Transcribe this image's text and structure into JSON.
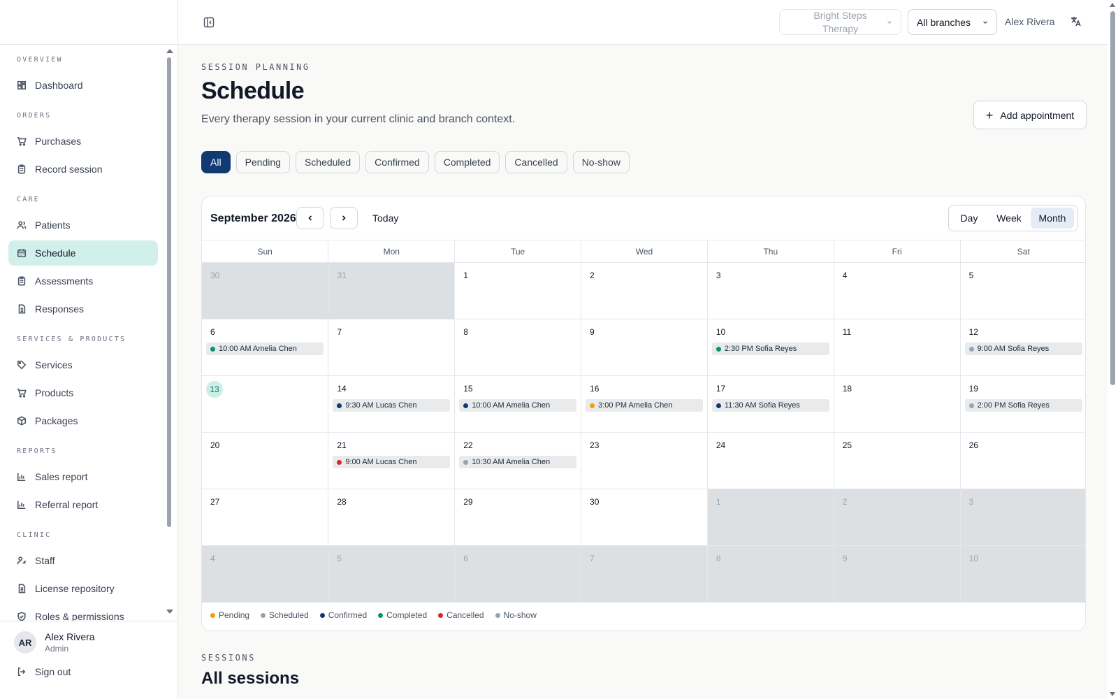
{
  "sidebar": {
    "sections": [
      {
        "label": "OVERVIEW",
        "items": [
          {
            "label": "Dashboard",
            "icon": "dashboard-icon"
          }
        ]
      },
      {
        "label": "ORDERS",
        "items": [
          {
            "label": "Purchases",
            "icon": "cart-icon"
          },
          {
            "label": "Record session",
            "icon": "clipboard-icon"
          }
        ]
      },
      {
        "label": "CARE",
        "items": [
          {
            "label": "Patients",
            "icon": "users-icon"
          },
          {
            "label": "Schedule",
            "icon": "calendar-icon",
            "active": true
          },
          {
            "label": "Assessments",
            "icon": "clipboard-icon"
          },
          {
            "label": "Responses",
            "icon": "file-icon"
          }
        ]
      },
      {
        "label": "SERVICES & PRODUCTS",
        "items": [
          {
            "label": "Services",
            "icon": "tag-icon"
          },
          {
            "label": "Products",
            "icon": "cart-icon"
          },
          {
            "label": "Packages",
            "icon": "package-icon"
          }
        ]
      },
      {
        "label": "REPORTS",
        "items": [
          {
            "label": "Sales report",
            "icon": "bar-chart-icon"
          },
          {
            "label": "Referral report",
            "icon": "bar-chart-icon"
          }
        ]
      },
      {
        "label": "CLINIC",
        "items": [
          {
            "label": "Staff",
            "icon": "staff-icon"
          },
          {
            "label": "License repository",
            "icon": "file-icon"
          },
          {
            "label": "Roles & permissions",
            "icon": "shield-icon"
          }
        ]
      }
    ],
    "user": {
      "initials": "AR",
      "name": "Alex Rivera",
      "role": "Admin"
    },
    "signout_label": "Sign out"
  },
  "header": {
    "clinic": "Bright Steps Therapy",
    "branch": "All branches",
    "user": "Alex Rivera"
  },
  "page": {
    "eyebrow": "SESSION PLANNING",
    "title": "Schedule",
    "subtitle": "Every therapy session in your current clinic and branch context.",
    "add_label": "Add appointment",
    "filters": [
      {
        "label": "All",
        "active": true
      },
      {
        "label": "Pending"
      },
      {
        "label": "Scheduled"
      },
      {
        "label": "Confirmed"
      },
      {
        "label": "Completed"
      },
      {
        "label": "Cancelled"
      },
      {
        "label": "No-show"
      }
    ]
  },
  "calendar": {
    "month_label": "September 2026",
    "today_label": "Today",
    "views": [
      {
        "label": "Day"
      },
      {
        "label": "Week"
      },
      {
        "label": "Month",
        "active": true
      }
    ],
    "weekdays": [
      "Sun",
      "Mon",
      "Tue",
      "Wed",
      "Thu",
      "Fri",
      "Sat"
    ],
    "status_colors": {
      "pending": "#f59e0b",
      "scheduled": "#9ca3af",
      "confirmed": "#123a72",
      "completed": "#059669",
      "cancelled": "#dc2626",
      "no_show": "#94a3b8"
    },
    "weeks": [
      [
        {
          "d": "30",
          "off": true
        },
        {
          "d": "31",
          "off": true
        },
        {
          "d": "1"
        },
        {
          "d": "2"
        },
        {
          "d": "3"
        },
        {
          "d": "4"
        },
        {
          "d": "5"
        }
      ],
      [
        {
          "d": "6",
          "event": {
            "time": "10:00 AM",
            "name": "Amelia Chen",
            "status": "completed"
          }
        },
        {
          "d": "7"
        },
        {
          "d": "8"
        },
        {
          "d": "9"
        },
        {
          "d": "10",
          "event": {
            "time": "2:30 PM",
            "name": "Sofia Reyes",
            "status": "completed"
          }
        },
        {
          "d": "11"
        },
        {
          "d": "12",
          "event": {
            "time": "9:00 AM",
            "name": "Sofia Reyes",
            "status": "no_show"
          }
        }
      ],
      [
        {
          "d": "13",
          "today": true
        },
        {
          "d": "14",
          "event": {
            "time": "9:30 AM",
            "name": "Lucas Chen",
            "status": "confirmed"
          }
        },
        {
          "d": "15",
          "event": {
            "time": "10:00 AM",
            "name": "Amelia Chen",
            "status": "confirmed"
          }
        },
        {
          "d": "16",
          "event": {
            "time": "3:00 PM",
            "name": "Amelia Chen",
            "status": "pending"
          }
        },
        {
          "d": "17",
          "event": {
            "time": "11:30 AM",
            "name": "Sofia Reyes",
            "status": "confirmed"
          }
        },
        {
          "d": "18"
        },
        {
          "d": "19",
          "event": {
            "time": "2:00 PM",
            "name": "Sofia Reyes",
            "status": "scheduled"
          }
        }
      ],
      [
        {
          "d": "20"
        },
        {
          "d": "21",
          "event": {
            "time": "9:00 AM",
            "name": "Lucas Chen",
            "status": "cancelled"
          }
        },
        {
          "d": "22",
          "event": {
            "time": "10:30 AM",
            "name": "Amelia Chen",
            "status": "scheduled"
          }
        },
        {
          "d": "23"
        },
        {
          "d": "24"
        },
        {
          "d": "25"
        },
        {
          "d": "26"
        }
      ],
      [
        {
          "d": "27"
        },
        {
          "d": "28"
        },
        {
          "d": "29"
        },
        {
          "d": "30"
        },
        {
          "d": "1",
          "off": true
        },
        {
          "d": "2",
          "off": true
        },
        {
          "d": "3",
          "off": true
        }
      ],
      [
        {
          "d": "4",
          "off": true
        },
        {
          "d": "5",
          "off": true
        },
        {
          "d": "6",
          "off": true
        },
        {
          "d": "7",
          "off": true
        },
        {
          "d": "8",
          "off": true
        },
        {
          "d": "9",
          "off": true
        },
        {
          "d": "10",
          "off": true
        }
      ]
    ],
    "legend": [
      {
        "label": "Pending",
        "status": "pending"
      },
      {
        "label": "Scheduled",
        "status": "scheduled"
      },
      {
        "label": "Confirmed",
        "status": "confirmed"
      },
      {
        "label": "Completed",
        "status": "completed"
      },
      {
        "label": "Cancelled",
        "status": "cancelled"
      },
      {
        "label": "No-show",
        "status": "no_show"
      }
    ]
  },
  "sessions": {
    "eyebrow": "SESSIONS",
    "title": "All sessions"
  }
}
